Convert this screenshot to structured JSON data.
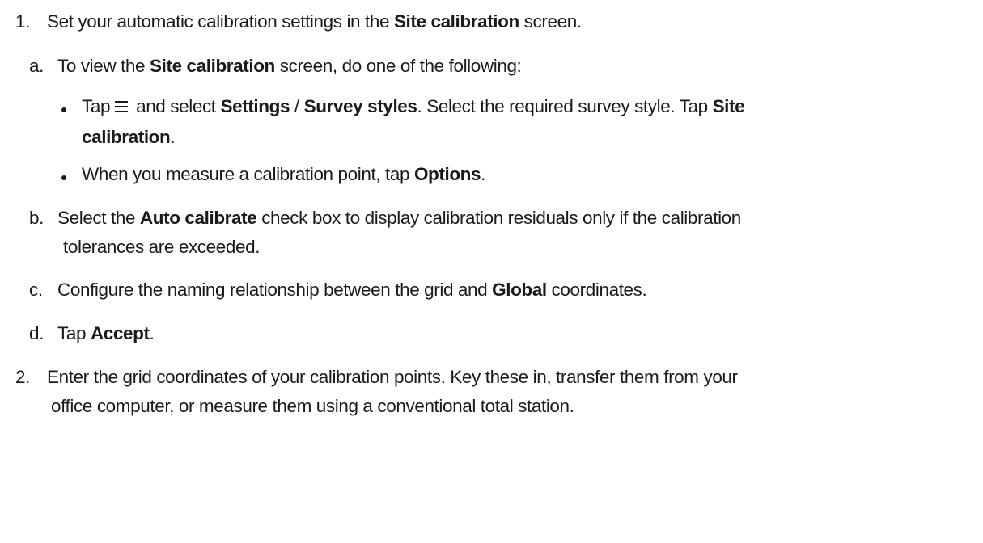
{
  "steps": [
    {
      "marker": "1.",
      "parts": [
        {
          "t": "Set your automatic calibration settings in the "
        },
        {
          "t": "Site calibration",
          "b": true
        },
        {
          "t": " screen."
        }
      ]
    },
    {
      "marker": "2.",
      "lines": [
        "Enter the grid coordinates of your calibration points. Key these in, transfer them from your",
        "office computer, or measure them using a conventional total station."
      ]
    }
  ],
  "substeps": [
    {
      "marker": "a.",
      "parts": [
        {
          "t": "To view the "
        },
        {
          "t": "Site calibration",
          "b": true
        },
        {
          "t": " screen, do one of the following:"
        }
      ]
    },
    {
      "marker": "b.",
      "line1": [
        {
          "t": "Select the "
        },
        {
          "t": "Auto calibrate",
          "b": true
        },
        {
          "t": " check box to display calibration residuals only if the calibration"
        }
      ],
      "line2": "tolerances are exceeded."
    },
    {
      "marker": "c.",
      "parts": [
        {
          "t": "Configure the naming relationship between the grid and "
        },
        {
          "t": "Global",
          "b": true
        },
        {
          "t": " coordinates."
        }
      ]
    },
    {
      "marker": "d.",
      "parts": [
        {
          "t": "Tap "
        },
        {
          "t": "Accept",
          "b": true
        },
        {
          "t": "."
        }
      ]
    }
  ],
  "bullets": [
    {
      "tap": "Tap",
      "icon": "menu-icon",
      "line1": [
        {
          "t": "and select "
        },
        {
          "t": "Settings",
          "b": true
        },
        {
          "t": " / "
        },
        {
          "t": "Survey styles",
          "b": true
        },
        {
          "t": ". Select the required survey style. Tap "
        },
        {
          "t": "Site",
          "b": true
        }
      ],
      "line2": [
        {
          "t": "calibration",
          "b": true
        },
        {
          "t": "."
        }
      ]
    },
    {
      "parts": [
        {
          "t": "When you measure a calibration point, tap "
        },
        {
          "t": "Options",
          "b": true
        },
        {
          "t": "."
        }
      ]
    }
  ]
}
